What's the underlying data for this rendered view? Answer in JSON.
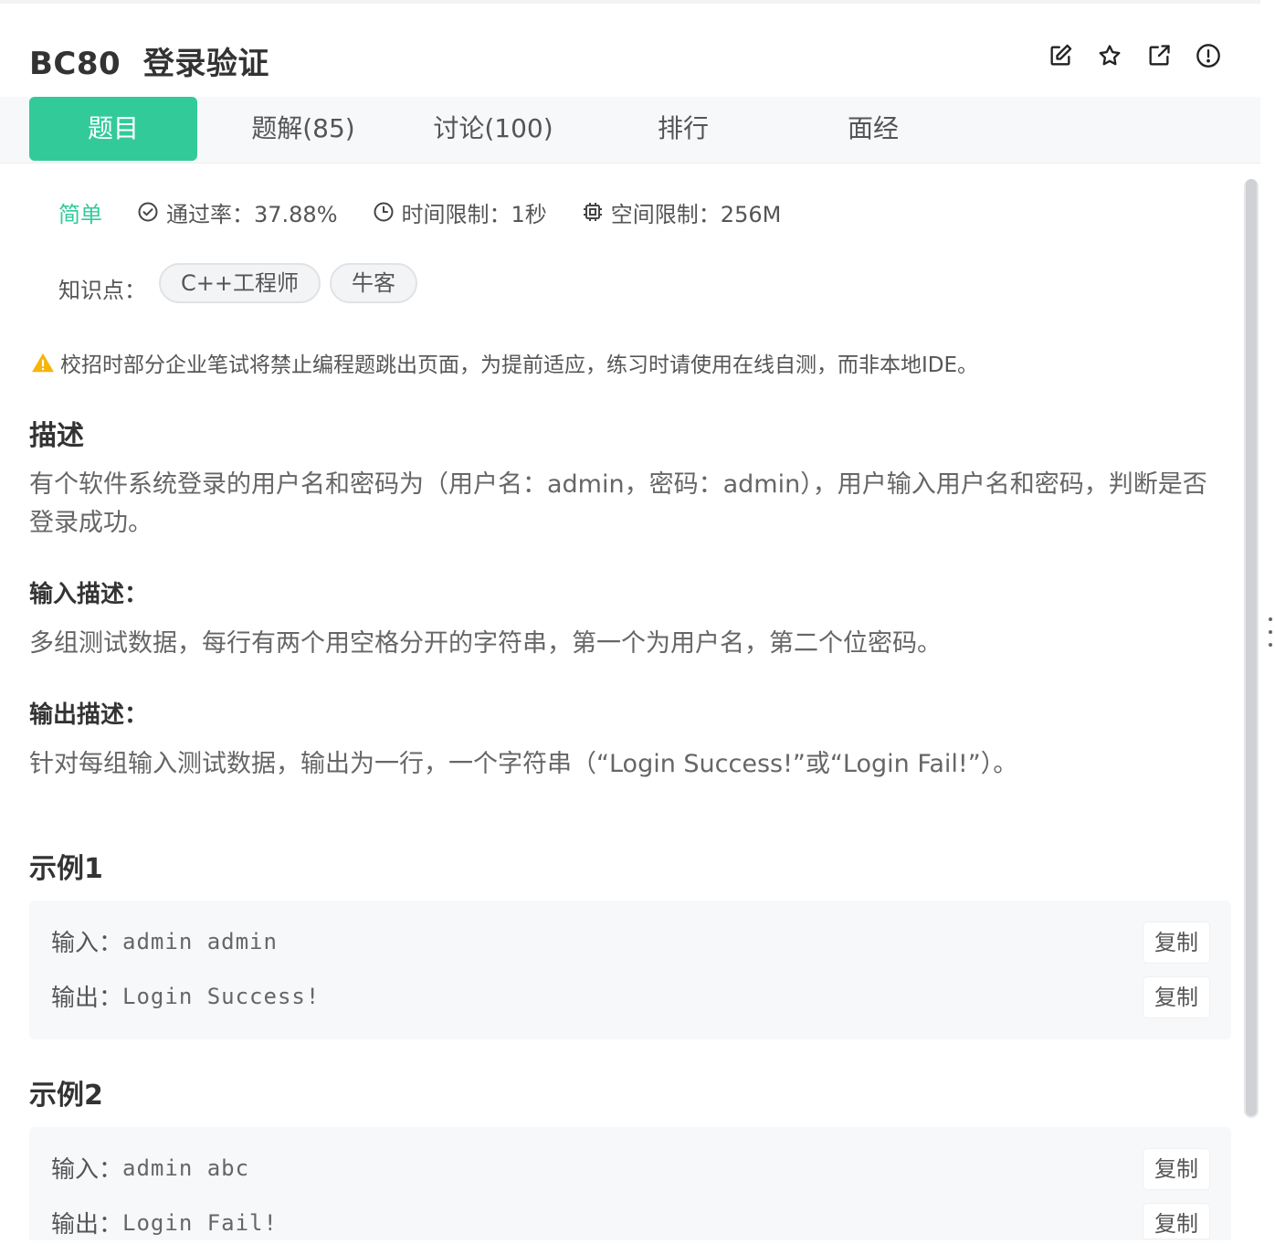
{
  "header": {
    "title": "BC80  登录验证",
    "icons": [
      "edit-icon",
      "star-icon",
      "share-icon",
      "report-icon"
    ]
  },
  "tabs": [
    {
      "label": "题目",
      "active": true
    },
    {
      "label": "题解(85)",
      "active": false
    },
    {
      "label": "讨论(100)",
      "active": false
    },
    {
      "label": "排行",
      "active": false
    },
    {
      "label": "面经",
      "active": false
    }
  ],
  "meta": {
    "difficulty": "简单",
    "pass_rate": "通过率：37.88%",
    "time_limit": "时间限制：1秒",
    "space_limit": "空间限制：256M"
  },
  "knowledge": {
    "label": "知识点：",
    "tags": [
      "C++工程师",
      "牛客"
    ]
  },
  "warning": "校招时部分企业笔试将禁止编程题跳出页面，为提前适应，练习时请使用在线自测，而非本地IDE。",
  "description": {
    "heading": "描述",
    "text": "有个软件系统登录的用户名和密码为（用户名：admin，密码：admin），用户输入用户名和密码，判断是否登录成功。"
  },
  "input_desc": {
    "heading": "输入描述：",
    "text": "多组测试数据，每行有两个用空格分开的字符串，第一个为用户名，第二个位密码。"
  },
  "output_desc": {
    "heading": "输出描述：",
    "text": "针对每组输入测试数据，输出为一行，一个字符串（“Login Success!”或“Login Fail!”）。"
  },
  "examples": [
    {
      "heading": "示例1",
      "input_label": "输入：",
      "input": "admin admin",
      "output_label": "输出：",
      "output": "Login Success!",
      "copy_label": "复制"
    },
    {
      "heading": "示例2",
      "input_label": "输入：",
      "input": "admin abc",
      "output_label": "输出：",
      "output": "Login Fail!",
      "copy_label": "复制"
    }
  ],
  "colors": {
    "accent": "#32ca99",
    "warning": "#f5b50a"
  }
}
